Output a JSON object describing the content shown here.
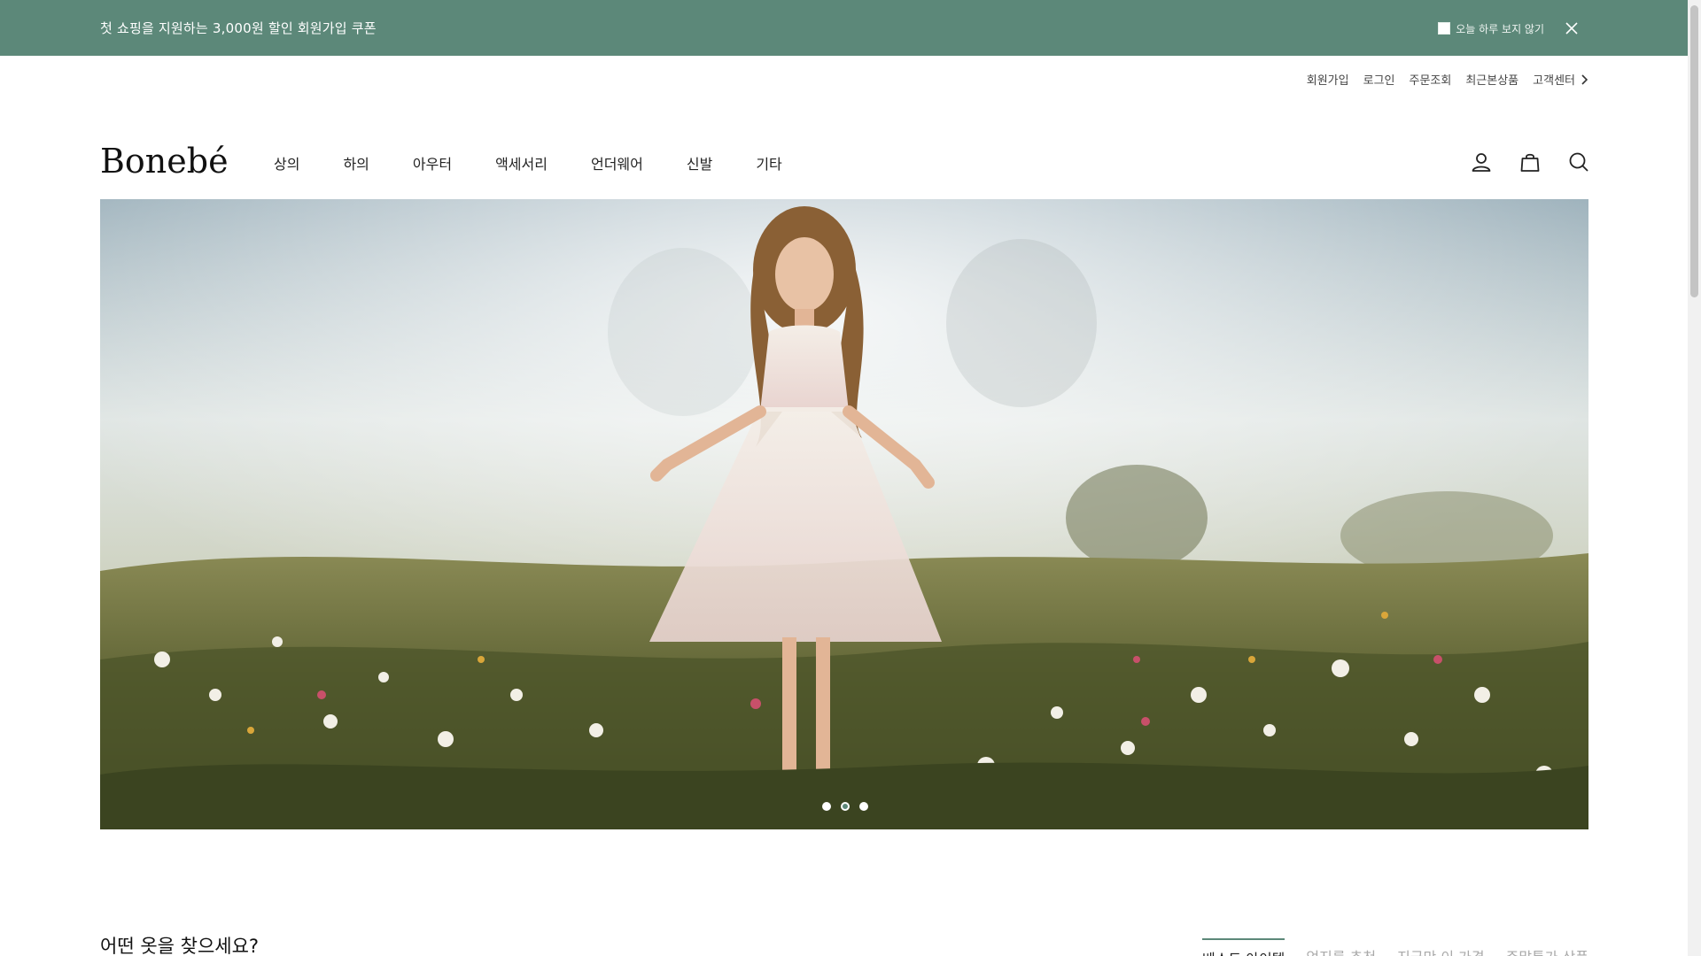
{
  "promo": {
    "text": "첫 쇼핑을 지원하는 3,000원 할인 회원가입 쿠폰",
    "dont_show_today": "오늘 하루 보지 않기",
    "close_icon": "close-icon",
    "background_color": "#5c8879"
  },
  "utility_nav": {
    "signup": "회원가입",
    "login": "로그인",
    "order_lookup": "주문조회",
    "recently_viewed": "최근본상품",
    "customer_center": "고객센터"
  },
  "header": {
    "logo": "Bonebé",
    "nav": [
      "상의",
      "하의",
      "아우터",
      "액세서리",
      "언더웨어",
      "신발",
      "기타"
    ],
    "icons": [
      "user-icon",
      "shopping-bag-icon",
      "search-icon"
    ]
  },
  "hero": {
    "slides": 3,
    "active_slide": 2
  },
  "section": {
    "title": "어떤 옷을 찾으세요?",
    "tabs": [
      "베스트 아이템",
      "엄지를 추천",
      "지금만 이 가격",
      "주말특가 상품"
    ],
    "active_tab": 0
  }
}
